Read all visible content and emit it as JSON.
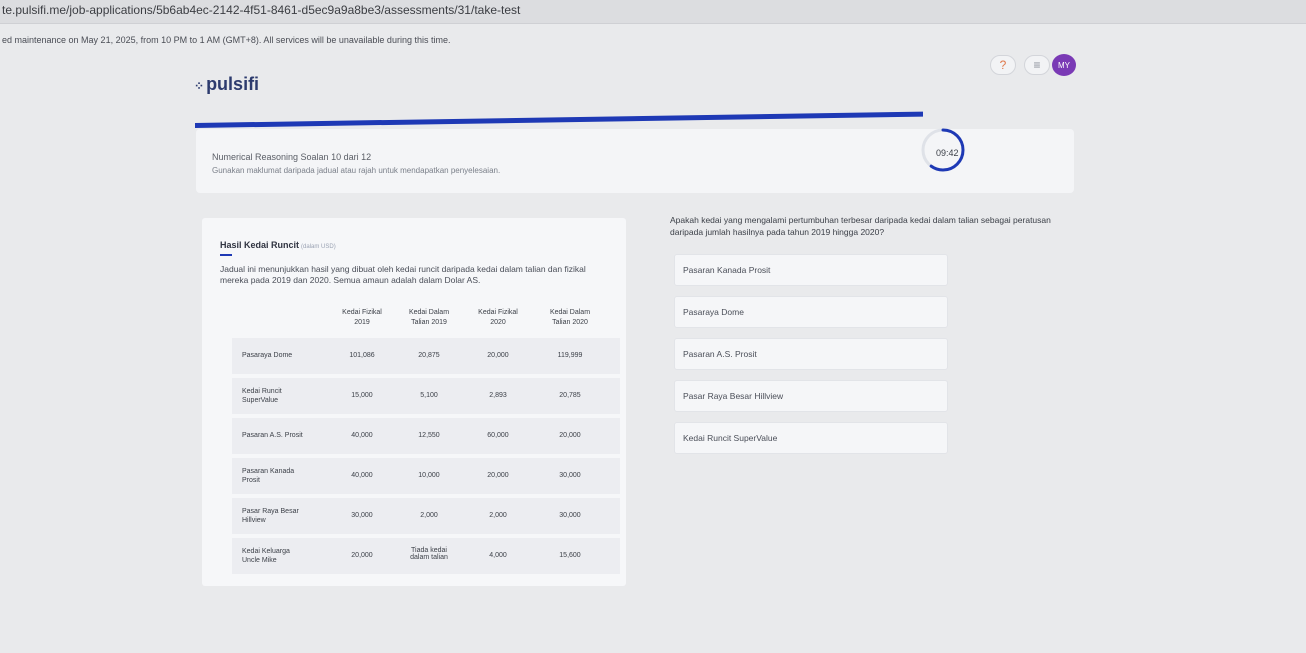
{
  "browser": {
    "url": "te.pulsifi.me/job-applications/5b6ab4ec-2142-4f51-8461-d5ec9a9a8be3/assessments/31/take-test"
  },
  "banner": {
    "text": "ed maintenance on May 21, 2025, from 10 PM to 1 AM (GMT+8). All services will be unavailable during this time."
  },
  "header": {
    "logo": "pulsifi",
    "help_icon": "?",
    "menu_icon": "≡",
    "avatar_initials": "MY"
  },
  "progress": {
    "fraction": 1.0
  },
  "question_card": {
    "title": "Numerical Reasoning Soalan 10 dari 12",
    "subtitle": "Gunakan maklumat daripada jadual atau rajah untuk mendapatkan penyelesaian.",
    "timer": "09:42",
    "timer_fraction": 0.6
  },
  "data_card": {
    "title": "Hasil Kedai Runcit",
    "unit": "(dalam USD)",
    "description": "Jadual ini menunjukkan hasil yang dibuat oleh kedai runcit daripada kedai dalam talian dan fizikal mereka pada 2019 dan 2020. Semua amaun adalah dalam Dolar AS.",
    "columns": [
      [
        "Kedai Fizikal",
        "2019"
      ],
      [
        "Kedai Dalam",
        "Talian 2019"
      ],
      [
        "Kedai Fizikal",
        "2020"
      ],
      [
        "Kedai Dalam",
        "Talian 2020"
      ]
    ],
    "rows": [
      {
        "name": [
          "Pasaraya Dome"
        ],
        "values": [
          [
            "101,086"
          ],
          [
            "20,875"
          ],
          [
            "20,000"
          ],
          [
            "119,999"
          ]
        ]
      },
      {
        "name": [
          "Kedai Runcit",
          "SuperValue"
        ],
        "values": [
          [
            "15,000"
          ],
          [
            "5,100"
          ],
          [
            "2,893"
          ],
          [
            "20,785"
          ]
        ]
      },
      {
        "name": [
          "Pasaran A.S. Prosit"
        ],
        "values": [
          [
            "40,000"
          ],
          [
            "12,550"
          ],
          [
            "60,000"
          ],
          [
            "20,000"
          ]
        ]
      },
      {
        "name": [
          "Pasaran Kanada",
          "Prosit"
        ],
        "values": [
          [
            "40,000"
          ],
          [
            "10,000"
          ],
          [
            "20,000"
          ],
          [
            "30,000"
          ]
        ]
      },
      {
        "name": [
          "Pasar Raya Besar",
          "Hillview"
        ],
        "values": [
          [
            "30,000"
          ],
          [
            "2,000"
          ],
          [
            "2,000"
          ],
          [
            "30,000"
          ]
        ]
      },
      {
        "name": [
          "Kedai Keluarga",
          "Uncle Mike"
        ],
        "values": [
          [
            "20,000"
          ],
          [
            "Tiada kedai",
            "dalam talian"
          ],
          [
            "4,000"
          ],
          [
            "15,600"
          ]
        ]
      }
    ]
  },
  "question": {
    "text": "Apakah kedai yang mengalami pertumbuhan terbesar daripada kedai dalam talian sebagai peratusan daripada jumlah hasilnya pada tahun 2019 hingga 2020?",
    "options": [
      "Pasaran Kanada Prosit",
      "Pasaraya Dome",
      "Pasaran A.S. Prosit",
      "Pasar Raya Besar Hillview",
      "Kedai Runcit SuperValue"
    ]
  }
}
